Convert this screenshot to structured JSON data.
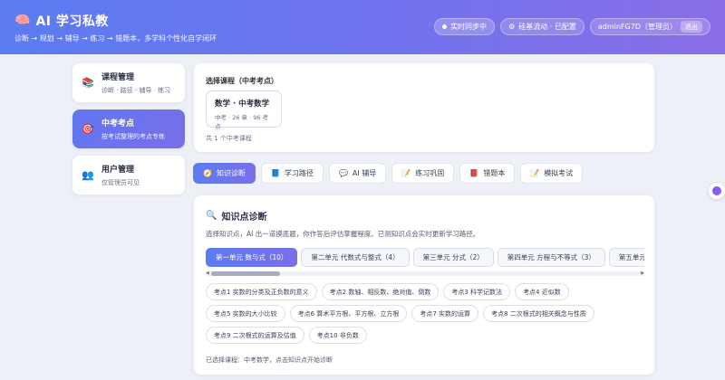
{
  "header": {
    "brand_icon": "brain-icon",
    "title": "AI 学习私教",
    "subtitle": "诊断 → 规划 → 辅导 → 练习 → 错题本，多学科个性化自学闭环",
    "sync_label": "实时同步中",
    "kb_label": "硅基流动 · 已配置",
    "user_label": "adminFG7D（管理员）",
    "logout_label": "退出"
  },
  "sidebar": {
    "items": [
      {
        "title": "课程管理",
        "desc": "诊断 · 路径 · 辅导 · 练习",
        "icon": "books-icon"
      },
      {
        "title": "中考考点",
        "desc": "按考试整理的考点专练",
        "icon": "target-icon"
      },
      {
        "title": "用户管理",
        "desc": "仅管理员可见",
        "icon": "users-icon"
      }
    ]
  },
  "course": {
    "label": "选择课程（中考考点）",
    "chip_name": "数学 · 中考数学",
    "chip_meta": "中考 · 26 章 · 96 考点",
    "count": "共 1 个中考课程"
  },
  "tabs": [
    {
      "label": "知识诊断",
      "icon": "compass-icon"
    },
    {
      "label": "学习路径",
      "icon": "book-icon"
    },
    {
      "label": "AI 辅导",
      "icon": "chat-icon"
    },
    {
      "label": "练习巩固",
      "icon": "memo-icon"
    },
    {
      "label": "错题本",
      "icon": "notebook-icon"
    },
    {
      "label": "模拟考试",
      "icon": "exam-icon"
    }
  ],
  "diagnosis": {
    "title": "知识点诊断",
    "desc": "选择知识点，AI 出一道摸底题，你作答后评估掌握程度。已测知识点会实时更新学习路径。",
    "units": [
      "第一单元 数与式（10）",
      "第二单元 代数式与整式（4）",
      "第三单元 分式（2）",
      "第四单元 方程与不等式（3）",
      "第五单元 方程（组）"
    ],
    "points": [
      "考点1 实数的分类及正负数的意义",
      "考点2 数轴、相反数、绝对值、倒数",
      "考点3 科学记数法",
      "考点4 近似数",
      "考点5 实数的大小比较",
      "考点6 算术平方根、平方根、立方根",
      "考点7 实数的运算",
      "考点8 二次根式的相关概念与性质",
      "考点9 二次根式的运算及估值",
      "考点10 非负数"
    ],
    "footer": "已选择课程：中考数学，点击知识点开始诊断"
  },
  "colors": {
    "accent": "#5b7cf0",
    "accent2": "#7a6fe9",
    "background": "#eef0f7"
  }
}
